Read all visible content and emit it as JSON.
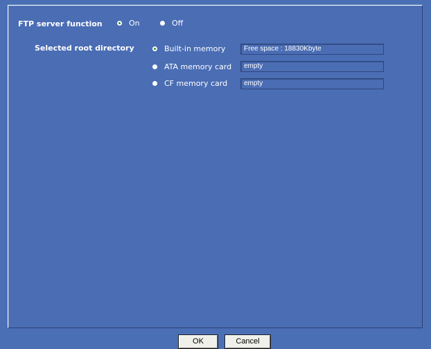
{
  "ftp": {
    "label": "FTP server function",
    "on_label": "On",
    "off_label": "Off",
    "selected": "On"
  },
  "root": {
    "label": "Selected root directory",
    "options": [
      {
        "label": "Built-in memory",
        "value": "Free space : 18830Kbyte",
        "selected": true
      },
      {
        "label": "ATA memory card",
        "value": "empty",
        "selected": false
      },
      {
        "label": "CF memory card",
        "value": "empty",
        "selected": false
      }
    ]
  },
  "buttons": {
    "ok": "OK",
    "cancel": "Cancel"
  },
  "colors": {
    "background": "#4a6fb5",
    "text": "#ffffff",
    "checked_dot": "#3d8a2c"
  }
}
